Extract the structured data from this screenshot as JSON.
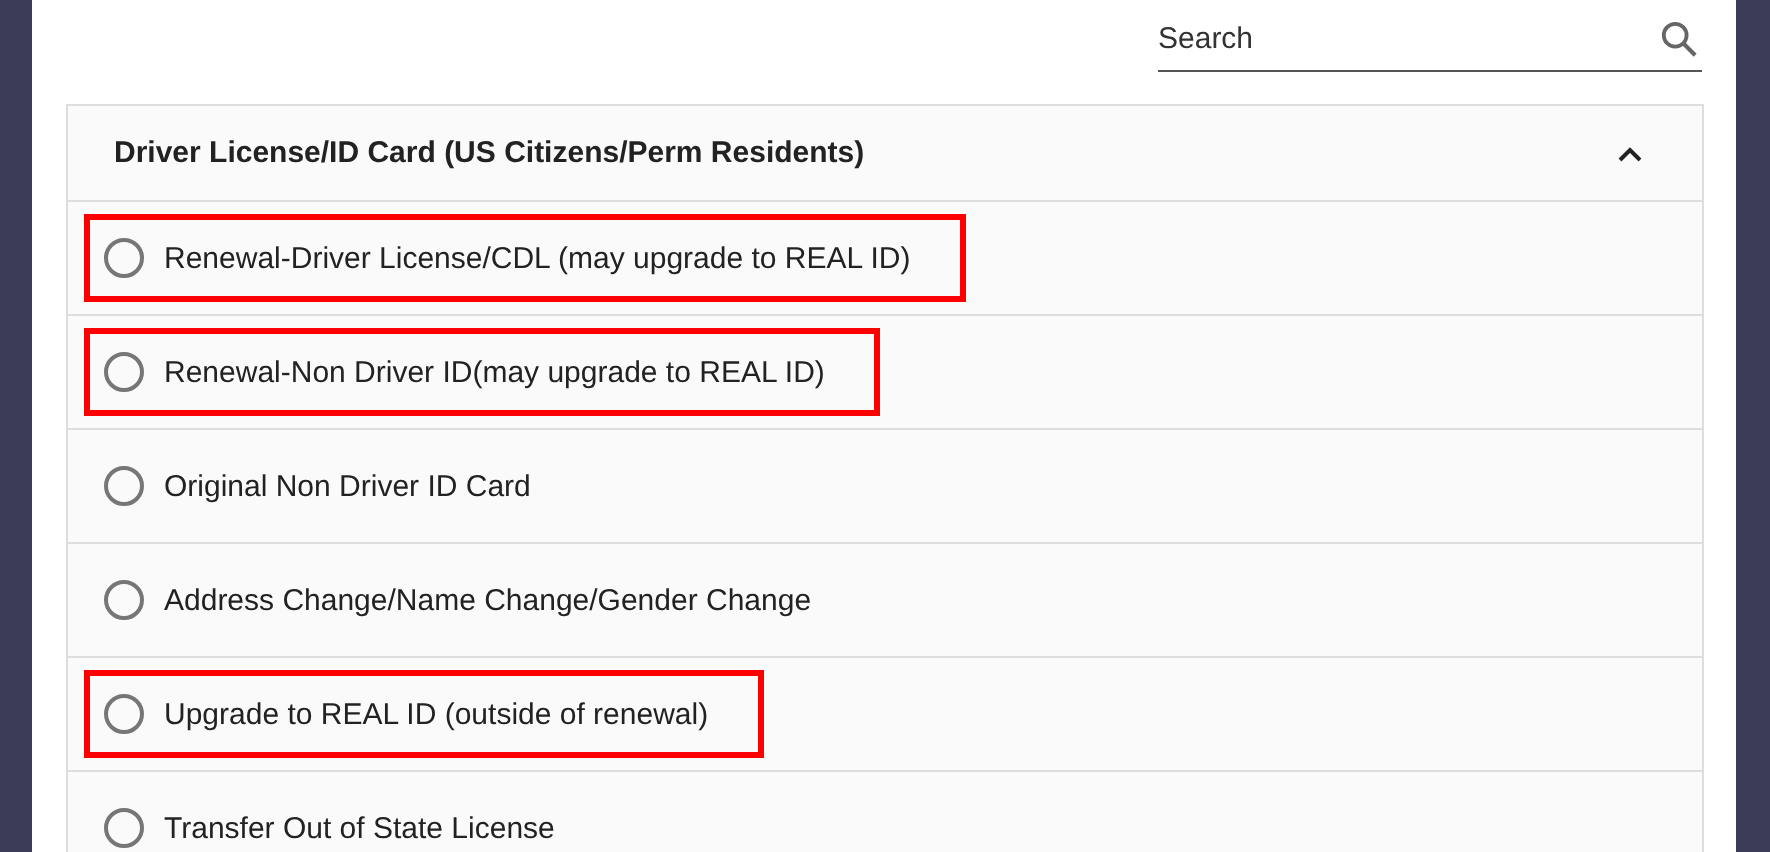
{
  "search": {
    "placeholder": "Search"
  },
  "section": {
    "title": "Driver License/ID Card (US Citizens/Perm Residents)",
    "expanded": true,
    "options": [
      {
        "label": "Renewal-Driver License/CDL (may upgrade to REAL ID)",
        "selected": false,
        "highlighted": true
      },
      {
        "label": "Renewal-Non Driver ID(may upgrade to REAL ID)",
        "selected": false,
        "highlighted": true
      },
      {
        "label": "Original Non Driver ID Card",
        "selected": false,
        "highlighted": false
      },
      {
        "label": "Address Change/Name Change/Gender Change",
        "selected": false,
        "highlighted": false
      },
      {
        "label": "Upgrade to REAL ID (outside of renewal)",
        "selected": false,
        "highlighted": true
      },
      {
        "label": "Transfer Out of State License",
        "selected": false,
        "highlighted": false
      }
    ]
  }
}
